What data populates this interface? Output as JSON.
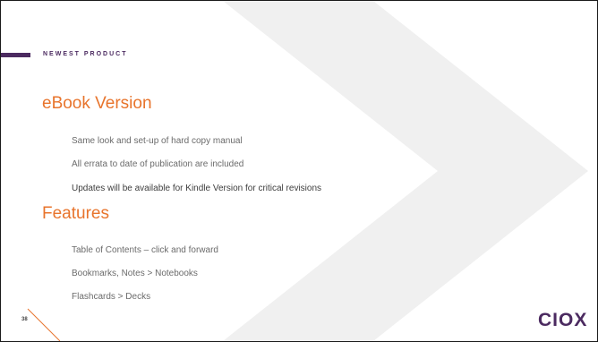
{
  "slide": {
    "kicker": "NEWEST PRODUCT",
    "section1": {
      "heading": "eBook Version",
      "bullets": [
        "Same look and set-up of hard copy manual",
        "All errata to date of publication are included",
        "Updates will be available for Kindle Version for critical revisions"
      ]
    },
    "section2": {
      "heading": "Features",
      "bullets": [
        "Table of Contents – click and forward",
        "Bookmarks, Notes > Notebooks",
        "Flashcards > Decks"
      ]
    },
    "page_number": "38",
    "logo_text": "CIOX"
  },
  "colors": {
    "accent_orange": "#e8742c",
    "brand_purple": "#4b2a60",
    "chevron_gray": "#f0f0f0"
  }
}
